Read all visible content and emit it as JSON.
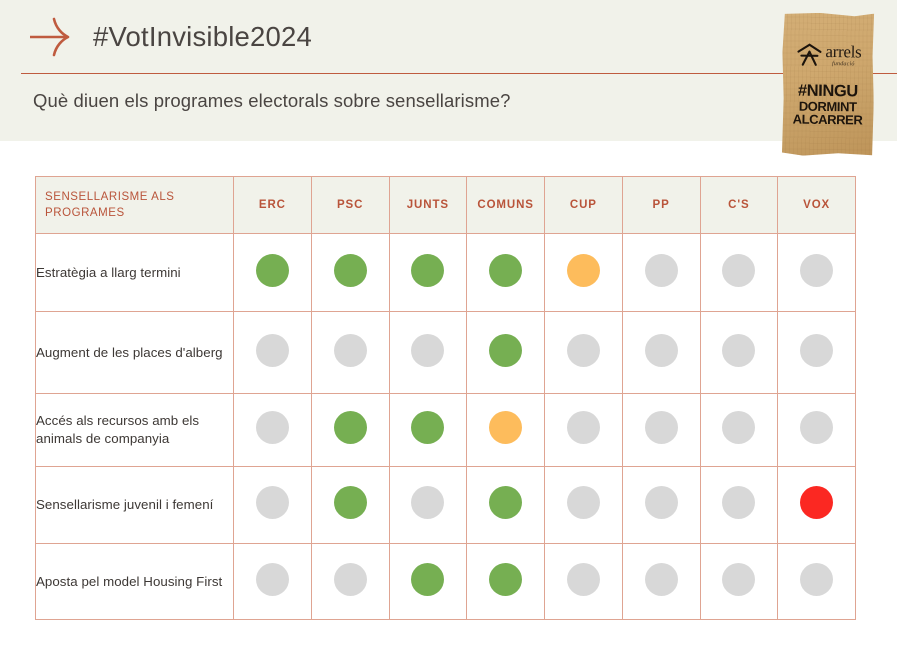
{
  "header": {
    "arrow_icon": "arrow-right-icon",
    "hashtag": "#VotInvisible2024",
    "subtitle": "Què diuen els programes electorals sobre sensellarisme?",
    "rule_color": "#BF5B3F",
    "band_bg": "#F1F2EA"
  },
  "logo": {
    "mark_icon": "arrels-house-icon",
    "brand": "arrels",
    "sub_brand": "fundació",
    "slogan_line1": "#NINGU",
    "slogan_line2": "DORMINT",
    "slogan_line3": "ALCARRER"
  },
  "table": {
    "corner_header_line1": "SENSELLARISME ALS",
    "corner_header_line2": "PROGRAMES",
    "columns": [
      {
        "label": "ERC"
      },
      {
        "label": "PSC"
      },
      {
        "label": "JUNTS"
      },
      {
        "label": "COMUNS"
      },
      {
        "label": "CUP"
      },
      {
        "label": "PP"
      },
      {
        "label": "C'S"
      },
      {
        "label": "VOX"
      }
    ],
    "rows": [
      {
        "label": "Estratègia a llarg termini",
        "values": [
          "green",
          "green",
          "green",
          "green",
          "orange",
          "grey",
          "grey",
          "grey"
        ]
      },
      {
        "label": "Augment de les places d'alberg",
        "values": [
          "grey",
          "grey",
          "grey",
          "green",
          "grey",
          "grey",
          "grey",
          "grey"
        ]
      },
      {
        "label": "Accés als recursos amb els animals de companyia",
        "values": [
          "grey",
          "green",
          "green",
          "orange",
          "grey",
          "grey",
          "grey",
          "grey"
        ]
      },
      {
        "label": "Sensellarisme juvenil i femení",
        "values": [
          "grey",
          "green",
          "grey",
          "green",
          "grey",
          "grey",
          "grey",
          "red"
        ]
      },
      {
        "label": "Aposta pel model Housing First",
        "values": [
          "grey",
          "grey",
          "green",
          "green",
          "grey",
          "grey",
          "grey",
          "grey"
        ]
      }
    ]
  },
  "colors": {
    "green": "#76AF52",
    "orange": "#FDBC5C",
    "red": "#FB2822",
    "grey": "#D8D8D8",
    "accent": "#B9543A",
    "border": "#DFA492",
    "text": "#3D3835"
  }
}
